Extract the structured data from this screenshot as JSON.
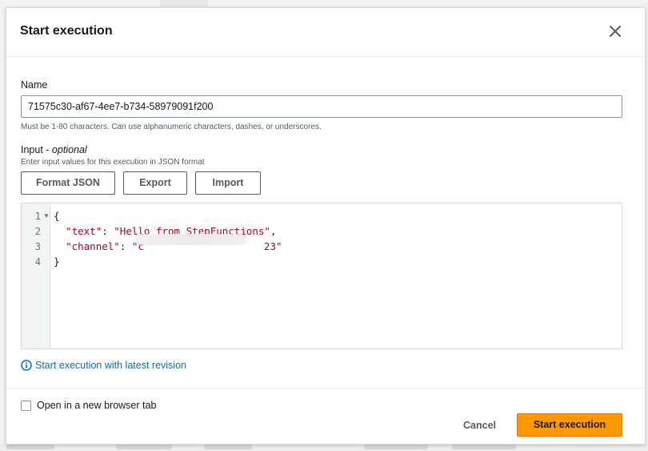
{
  "modal": {
    "title": "Start execution"
  },
  "name_field": {
    "label": "Name",
    "value": "71575c30-af67-4ee7-b734-58979091f200",
    "hint": "Must be 1-80 characters. Can use alphanumeric characters, dashes, or underscores."
  },
  "input_field": {
    "label": "Input - ",
    "label_optional": "optional",
    "hint": "Enter input values for this execution in JSON format"
  },
  "toolbar": {
    "format_label": "Format JSON",
    "export_label": "Export",
    "import_label": "Import"
  },
  "editor": {
    "line_numbers": [
      "1",
      "2",
      "3",
      "4"
    ],
    "lines": {
      "l1": "{",
      "l2_key": "\"text\"",
      "l2_sep": ": ",
      "l2_val": "\"Hello from StepFunctions\"",
      "l2_end": ",",
      "l3_key": "\"channel\"",
      "l3_sep": ": ",
      "l3_val_start": "\"c",
      "l3_val_end": "23\"",
      "l4": "}"
    }
  },
  "revision_link": "Start execution with latest revision",
  "footer": {
    "checkbox_label": "Open in a new browser tab",
    "cancel_label": "Cancel",
    "primary_label": "Start execution"
  },
  "colors": {
    "accent": "#ff9900",
    "link": "#0073bb",
    "json_string": "#b0001e"
  }
}
